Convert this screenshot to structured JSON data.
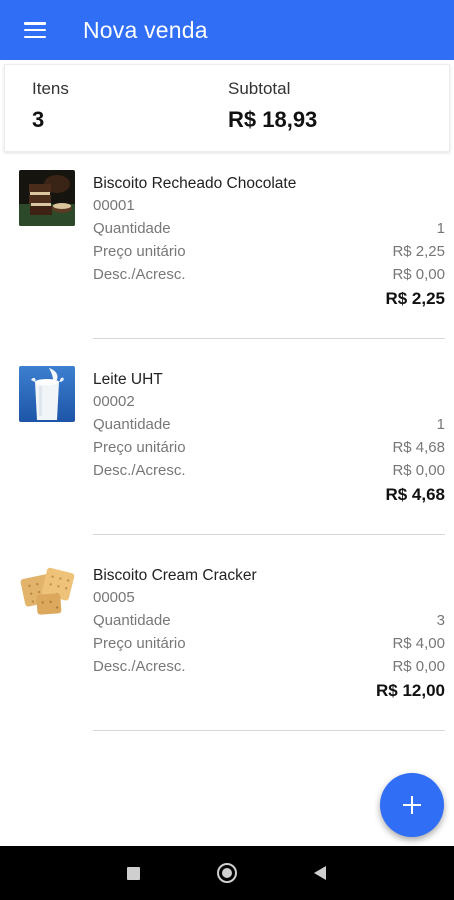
{
  "app_bar": {
    "title": "Nova venda",
    "menu_icon": "hamburger-menu-icon",
    "color": "#2f6ef5"
  },
  "summary": {
    "items_label": "Itens",
    "items_value": "3",
    "subtotal_label": "Subtotal",
    "subtotal_value": "R$ 18,93"
  },
  "labels": {
    "quantity": "Quantidade",
    "unit_price": "Preço unitário",
    "discount": "Desc./Acresc."
  },
  "items": [
    {
      "name": "Biscoito Recheado Chocolate",
      "code": "00001",
      "quantity": "1",
      "unit_price": "R$ 2,25",
      "discount": "R$ 0,00",
      "total": "R$ 2,25",
      "image": "chocolate-cookies-photo"
    },
    {
      "name": "Leite UHT",
      "code": "00002",
      "quantity": "1",
      "unit_price": "R$ 4,68",
      "discount": "R$ 0,00",
      "total": "R$ 4,68",
      "image": "milk-glass-photo"
    },
    {
      "name": "Biscoito Cream Cracker",
      "code": "00005",
      "quantity": "3",
      "unit_price": "R$ 4,00",
      "discount": "R$ 0,00",
      "total": "R$ 12,00",
      "image": "cream-cracker-photo"
    }
  ],
  "fab": {
    "icon": "plus-icon"
  },
  "system_nav": {
    "recent": "square-recent-apps-icon",
    "home": "circle-home-icon",
    "back": "triangle-back-icon"
  }
}
